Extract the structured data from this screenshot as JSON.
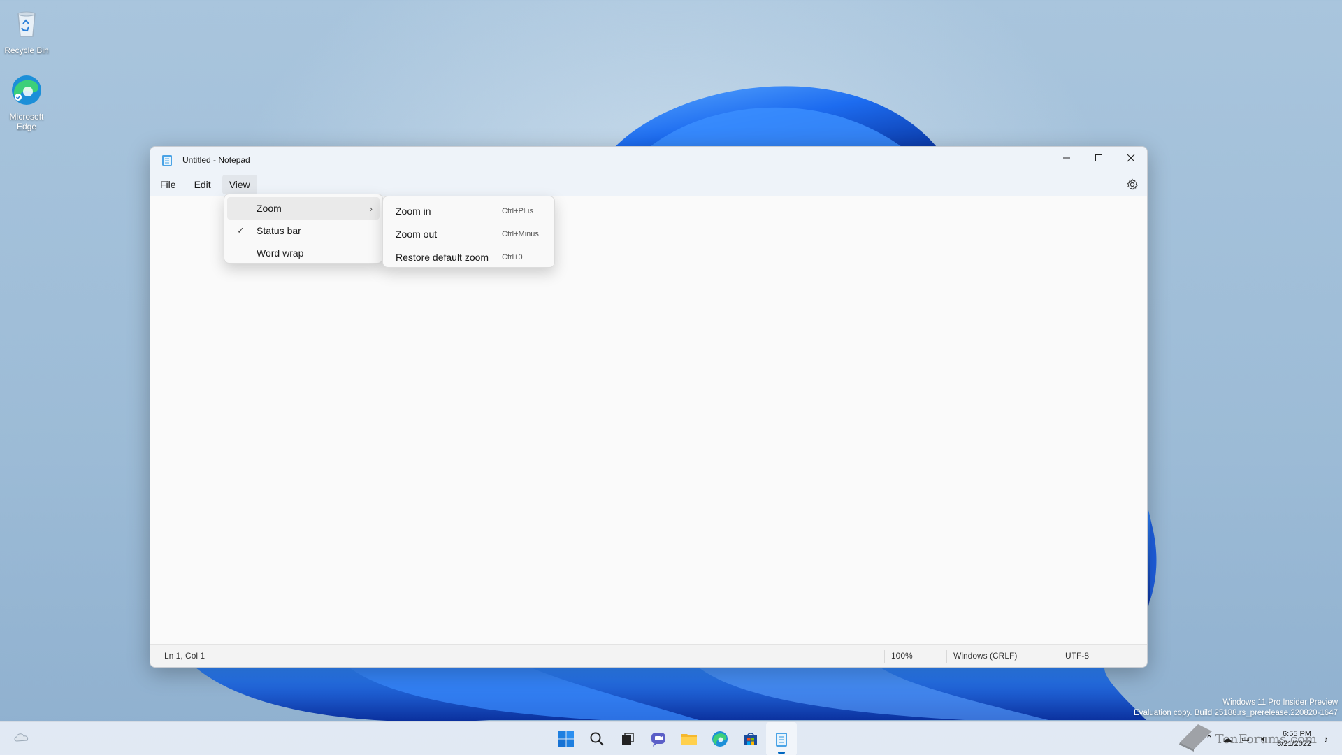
{
  "desktop": {
    "icons": [
      {
        "label": "Recycle Bin"
      },
      {
        "label": "Microsoft Edge"
      }
    ],
    "watermark": {
      "line1": "Windows 11 Pro Insider Preview",
      "line2": "Evaluation copy. Build 25188.rs_prerelease.220820-1647"
    }
  },
  "window": {
    "title": "Untitled - Notepad",
    "menu": [
      "File",
      "Edit",
      "View"
    ],
    "active_menu": "View"
  },
  "view_menu": {
    "items": [
      {
        "label": "Zoom",
        "has_submenu": true,
        "checked": false
      },
      {
        "label": "Status bar",
        "has_submenu": false,
        "checked": true
      },
      {
        "label": "Word wrap",
        "has_submenu": false,
        "checked": false
      }
    ]
  },
  "zoom_menu": {
    "items": [
      {
        "label": "Zoom in",
        "shortcut": "Ctrl+Plus"
      },
      {
        "label": "Zoom out",
        "shortcut": "Ctrl+Minus"
      },
      {
        "label": "Restore default zoom",
        "shortcut": "Ctrl+0"
      }
    ]
  },
  "statusbar": {
    "position": "Ln 1, Col 1",
    "zoom": "100%",
    "line_ending": "Windows (CRLF)",
    "encoding": "UTF-8"
  },
  "taskbar": {
    "clock_time": "6:55 PM",
    "clock_date": "8/21/2022",
    "watermark_text": "TenForums.com",
    "apps": [
      "start",
      "search",
      "task-view",
      "chat",
      "file-explorer",
      "edge",
      "store",
      "notepad"
    ]
  },
  "colors": {
    "accent": "#0067c0",
    "window_bg": "#f9f9f9",
    "titlebar_bg": "#eef3f9"
  }
}
